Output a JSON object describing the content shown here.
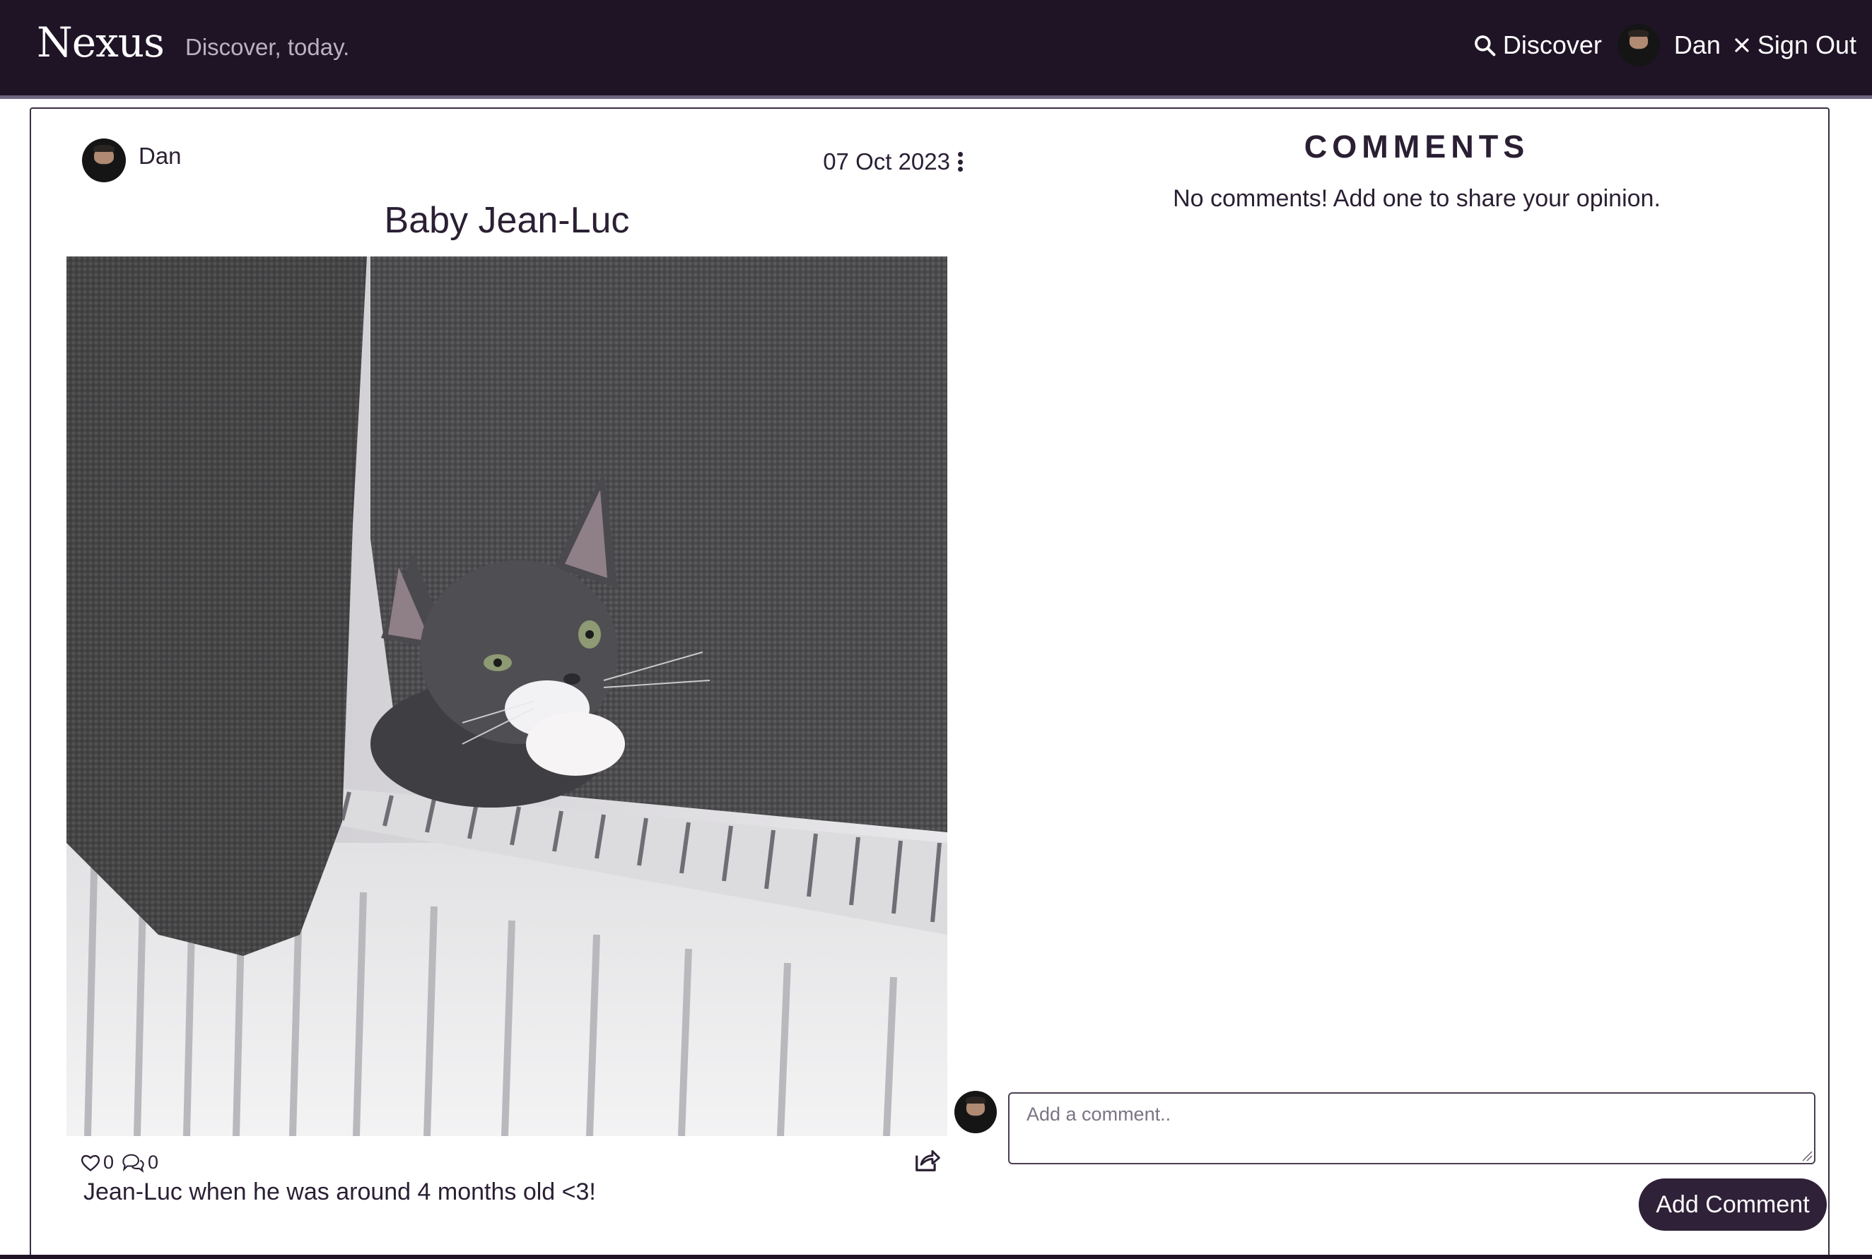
{
  "navbar": {
    "brand": "Nexus",
    "tagline": "Discover, today.",
    "discover_label": "Discover",
    "user_name": "Dan",
    "sign_out_label": "Sign Out"
  },
  "post": {
    "author": "Dan",
    "date": "07 Oct 2023",
    "title": "Baby Jean-Luc",
    "likes": "0",
    "comments_count": "0",
    "caption": "Jean-Luc when he was around 4 months old <3!"
  },
  "comments": {
    "heading": "COMMENTS",
    "empty_message": "No comments! Add one to share your opinion.",
    "input_placeholder": "Add a comment..",
    "submit_label": "Add Comment"
  },
  "colors": {
    "navbar_bg": "#1f1426",
    "accent": "#2f2138",
    "text": "#2a1f33"
  },
  "icons": [
    "search-icon",
    "close-icon",
    "kebab-menu-icon",
    "heart-icon",
    "comments-icon",
    "share-icon"
  ]
}
